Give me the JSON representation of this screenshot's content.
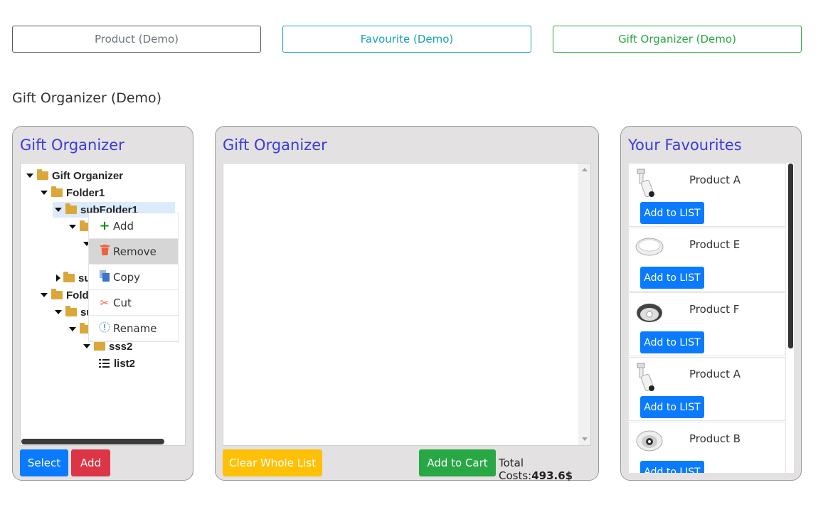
{
  "top_buttons": {
    "product": "Product (Demo)",
    "favourite": "Favourite (Demo)",
    "gift_organizer": "Gift Organizer (Demo)"
  },
  "page_heading": "Gift Organizer (Demo)",
  "tree_panel": {
    "title": "Gift Organizer",
    "nodes": {
      "root": "Gift Organizer",
      "folder1": "Folder1",
      "subfolder1": "subFolder1",
      "sub_partial": "su",
      "folder2_partial": "Fold",
      "sub2_partial": "su",
      "sss2": "sss2",
      "list2": "list2"
    },
    "select_label": "Select",
    "add_label": "Add"
  },
  "context_menu": {
    "add": "Add",
    "remove": "Remove",
    "copy": "Copy",
    "cut": "Cut",
    "rename": "Rename"
  },
  "list_panel": {
    "title": "Gift Organizer",
    "clear_label": "Clear Whole List",
    "cart_label": "Add to Cart",
    "total_label": "Total Costs:",
    "total_value": "493.6$"
  },
  "favourites": {
    "title": "Your Favourites",
    "items": [
      {
        "name": "Product A",
        "button": "Add to LIST",
        "icon": "track-light"
      },
      {
        "name": "Product E",
        "button": "Add to LIST",
        "icon": "round-panel-light"
      },
      {
        "name": "Product F",
        "button": "Add to LIST",
        "icon": "downlight"
      },
      {
        "name": "Product A",
        "button": "Add to LIST",
        "icon": "track-light"
      },
      {
        "name": "Product B",
        "button": "Add to LIST",
        "icon": "recessed-spot"
      }
    ]
  },
  "colors": {
    "panel_title": "#3b3bd9",
    "primary": "#0a7bff",
    "danger": "#dc3545",
    "warning": "#ffc107",
    "success": "#28a745",
    "info": "#17a2b8"
  }
}
